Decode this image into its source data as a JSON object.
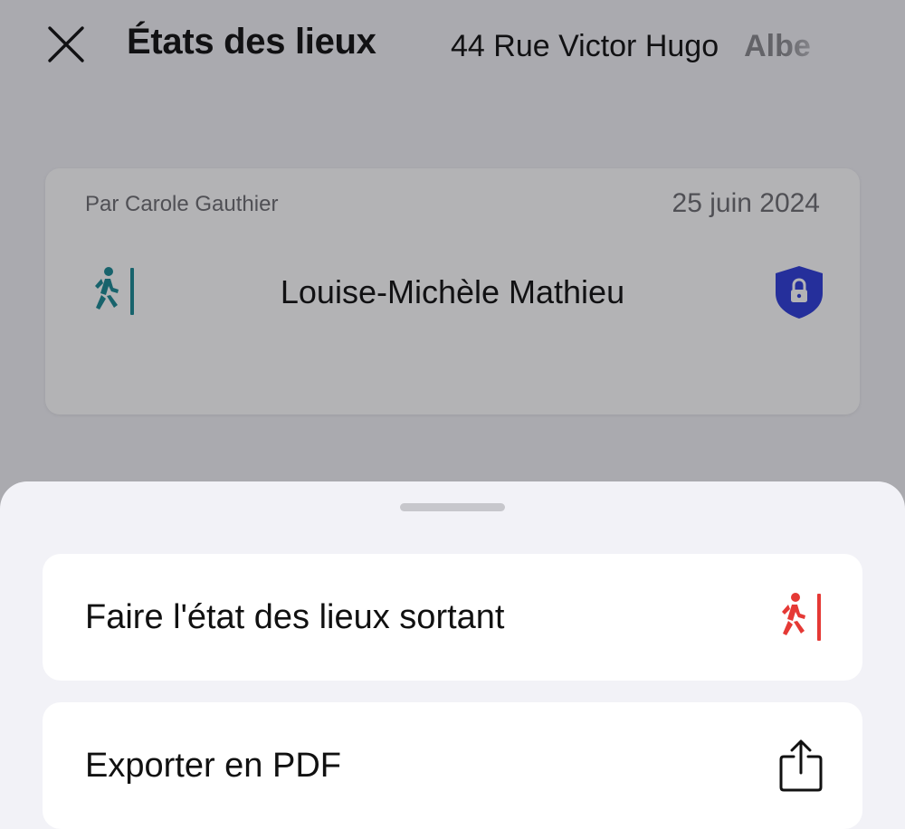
{
  "header": {
    "title": "États des lieux",
    "tabs": [
      {
        "label": "44 Rue Victor Hugo",
        "active": true
      },
      {
        "label": "Albe",
        "active": false
      }
    ]
  },
  "card": {
    "author": "Par Carole Gauthier",
    "date": "25 juin 2024",
    "tenant_name": "Louise-Michèle Mathieu",
    "entry_icon": "walk-in-icon",
    "status_icon": "lock-shield-icon"
  },
  "sheet": {
    "actions": [
      {
        "label": "Faire l'état des lieux sortant",
        "icon": "walk-out-icon"
      },
      {
        "label": "Exporter en PDF",
        "icon": "share-icon"
      }
    ]
  },
  "colors": {
    "entry_teal": "#1b8a94",
    "exit_red": "#e53935",
    "shield_blue": "#2f3dd9"
  }
}
